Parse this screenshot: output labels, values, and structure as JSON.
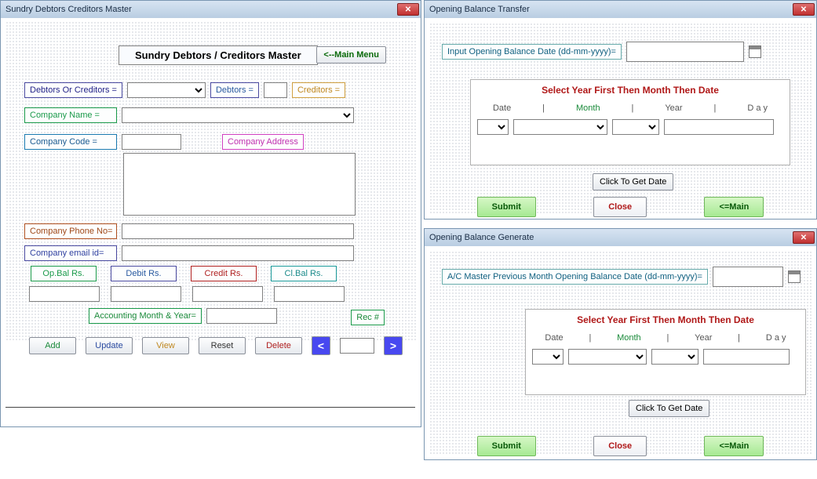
{
  "w1": {
    "title": "Sundry Debtors Creditors Master",
    "panel_title": "Sundry Debtors / Creditors Master",
    "main_menu": "<--Main Menu",
    "labels": {
      "doc_or_cred": "Debtors Or Creditors =",
      "debtors": "Debtors =",
      "creditors": "Creditors =",
      "company_name": "Company Name  =",
      "company_code": "Company Code   =",
      "company_address": "Company Address",
      "company_phone": "Company Phone No=",
      "company_email": "Company email id=",
      "op_bal": "Op.Bal Rs.",
      "debit": "Debit Rs.",
      "credit": "Credit Rs.",
      "cl_bal": "Cl.Bal Rs.",
      "acct_month": "Accounting Month & Year=",
      "rec_no": "Rec #"
    },
    "buttons": {
      "add": "Add",
      "update": "Update",
      "view": "View",
      "reset": "Reset",
      "delete": "Delete",
      "prev": "<",
      "next": ">"
    }
  },
  "w2": {
    "title": "Opening Balance Transfer",
    "input_label": "Input Opening Balance Date (dd-mm-yyyy)=",
    "section": "Select Year First Then Month Then Date",
    "cols": {
      "date": "Date",
      "month": "Month",
      "year": "Year",
      "day": "D a y"
    },
    "click_get": "Click To Get Date",
    "submit": "Submit",
    "close": "Close",
    "main": "<=Main"
  },
  "w3": {
    "title": "Opening Balance Generate",
    "input_label": "A/C Master Previous Month Opening Balance Date (dd-mm-yyyy)=",
    "section": "Select Year First Then Month Then Date",
    "cols": {
      "date": "Date",
      "month": "Month",
      "year": "Year",
      "day": "D a y"
    },
    "click_get": "Click To Get Date",
    "submit": "Submit",
    "close": "Close",
    "main": "<=Main"
  }
}
